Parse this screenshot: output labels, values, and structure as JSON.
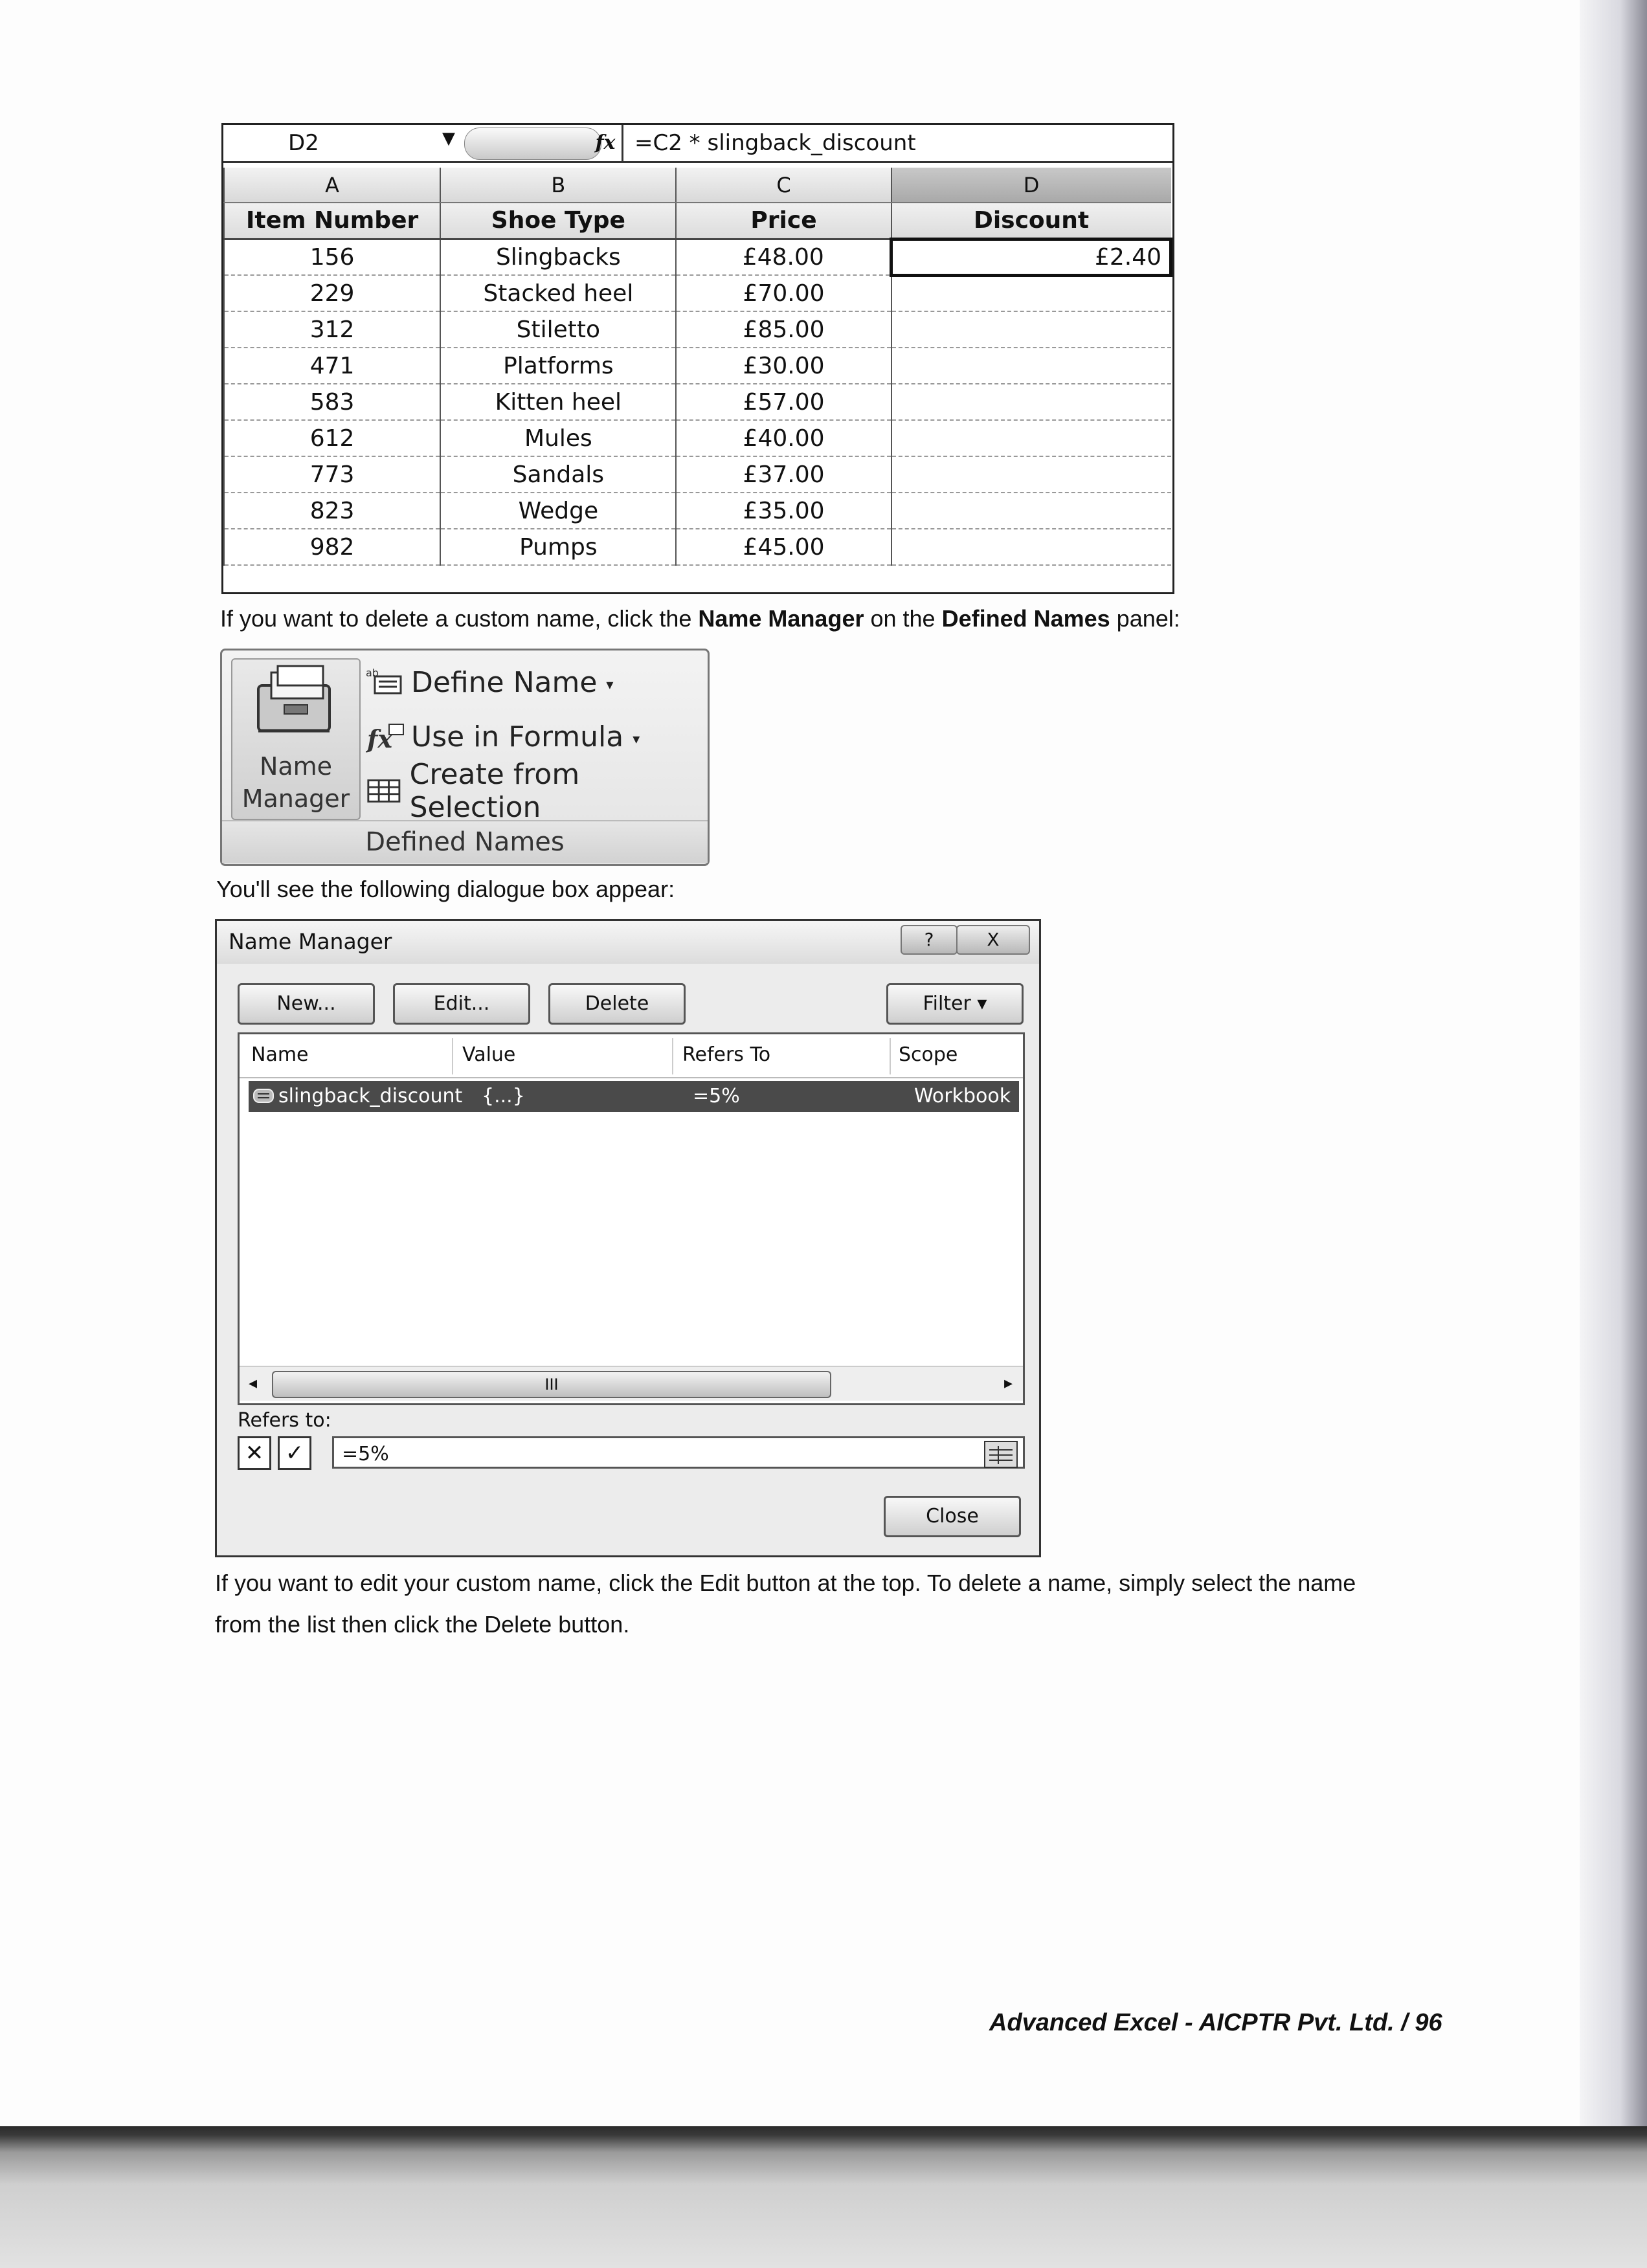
{
  "spreadsheet": {
    "cell_ref": "D2",
    "fx": "fx",
    "formula": "=C2 * slingback_discount",
    "columns": [
      "A",
      "B",
      "C",
      "D"
    ],
    "headers": [
      "Item Number",
      "Shoe Type",
      "Price",
      "Discount"
    ],
    "rows": [
      [
        "156",
        "Slingbacks",
        "£48.00",
        "£2.40"
      ],
      [
        "229",
        "Stacked heel",
        "£70.00",
        ""
      ],
      [
        "312",
        "Stiletto",
        "£85.00",
        ""
      ],
      [
        "471",
        "Platforms",
        "£30.00",
        ""
      ],
      [
        "583",
        "Kitten heel",
        "£57.00",
        ""
      ],
      [
        "612",
        "Mules",
        "£40.00",
        ""
      ],
      [
        "773",
        "Sandals",
        "£37.00",
        ""
      ],
      [
        "823",
        "Wedge",
        "£35.00",
        ""
      ],
      [
        "982",
        "Pumps",
        "£45.00",
        ""
      ]
    ]
  },
  "para1": {
    "a": "If you want to delete a custom name, click the ",
    "b": "Name Manager",
    "c": " on the ",
    "d": "Defined Names",
    "e": " panel:"
  },
  "ribbon": {
    "name_manager_line1": "Name",
    "name_manager_line2": "Manager",
    "define_name": "Define Name",
    "use_in_formula": "Use in Formula",
    "create_from_selection": "Create from Selection",
    "group_label": "Defined Names",
    "caret": "▾"
  },
  "para2": "You'll see the following dialogue box appear:",
  "dialog": {
    "title": "Name Manager",
    "help": "?",
    "close_x": "X",
    "buttons": {
      "new": "New...",
      "edit": "Edit...",
      "delete": "Delete",
      "filter": "Filter ▾"
    },
    "columns": [
      "Name",
      "Value",
      "Refers To",
      "Scope"
    ],
    "selected_row": {
      "name": "slingback_discount",
      "value": "{...}",
      "refers_to": "=5%",
      "scope": "Workbook"
    },
    "scroll_left": "◂",
    "scroll_right": "▸",
    "scroll_grip": "III",
    "refers_to_label": "Refers to:",
    "cancel_mark": "✕",
    "confirm_mark": "✓",
    "refers_to_value": "=5%",
    "close_button": "Close"
  },
  "para3": {
    "line1": "If you want to edit your custom name, click the Edit button at the top. To delete a name, simply select the name",
    "line2": "from the list then click the Delete button."
  },
  "footer": "Advanced Excel - AICPTR Pvt. Ltd.  / 96"
}
